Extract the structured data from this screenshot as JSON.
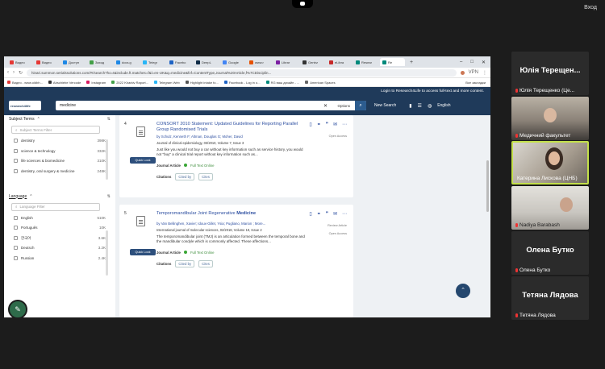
{
  "conference": {
    "exit_label": "Вход"
  },
  "browser": {
    "tabs": [
      {
        "label": "Видео",
        "color": "#e53935"
      },
      {
        "label": "Видео",
        "color": "#e53935"
      },
      {
        "label": "Доступ",
        "color": "#1e88e5"
      },
      {
        "label": "Заход",
        "color": "#43a047"
      },
      {
        "label": "docs.g",
        "color": "#1e88e5"
      },
      {
        "label": "Telegr",
        "color": "#29b6f6"
      },
      {
        "label": "Facebo",
        "color": "#1e63c4"
      },
      {
        "label": "DeepL",
        "color": "#0f2b46"
      },
      {
        "label": "Google",
        "color": "#4285f4"
      },
      {
        "label": "www.r",
        "color": "#e65100"
      },
      {
        "label": "Librar",
        "color": "#7b1fa2"
      },
      {
        "label": "Gentrz",
        "color": "#333333"
      },
      {
        "label": "eLibra",
        "color": "#c62828"
      },
      {
        "label": "Resear",
        "color": "#00897b"
      },
      {
        "label": "Re",
        "color": "#00897b",
        "active": true
      }
    ],
    "url": "hinari.summon.serialssolutions.com/#!/search?ho=t&include.ft.matches=f&l=en-UK&q=medicine&fvf=ContentType,Journal%20Article,f%7CDisciplin...",
    "vpn_label": "VPN",
    "bookmarks": [
      {
        "label": "Видео - www.oldbh...",
        "color": "#e53935"
      },
      {
        "label": "Abschiebe Vercode",
        "color": "#333333"
      },
      {
        "label": "Instagram",
        "color": "#d81b60"
      },
      {
        "label": "2022 Kharkiv Raport...",
        "color": "#43a047"
      },
      {
        "label": "Telegram Web",
        "color": "#29b6f6"
      },
      {
        "label": "Highlight intake fo...",
        "color": "#555555"
      },
      {
        "label": "Facebook - Log in o...",
        "color": "#1e63c4"
      },
      {
        "label": "RG ваш дизайн - ...",
        "color": "#00897b"
      },
      {
        "label": "American Spaces",
        "color": "#666666"
      }
    ],
    "bookmarks_all": "Все закладки"
  },
  "research4life": {
    "login_text": "Login to Research4Life to access full-text and more content.",
    "logo_text": "research4life",
    "search_value": "medicine",
    "options_label": "Options",
    "new_search_label": "New Search",
    "language_label": "English"
  },
  "facets": {
    "subject": {
      "title": "Subject Terms",
      "filter_placeholder": "Subject Terms Filter",
      "items": [
        {
          "label": "dentistry",
          "count": "398K"
        },
        {
          "label": "science & technology",
          "count": "332K"
        },
        {
          "label": "life sciences & biomedicine",
          "count": "310K"
        },
        {
          "label": "dentistry, oral surgery & medicine",
          "count": "248K"
        }
      ]
    },
    "language": {
      "title": "Language",
      "filter_placeholder": "Language Filter",
      "items": [
        {
          "label": "English",
          "count": "510K"
        },
        {
          "label": "Português",
          "count": "10K"
        },
        {
          "label": "한국어",
          "count": "3.6K"
        },
        {
          "label": "Deutsch",
          "count": "3.2K"
        },
        {
          "label": "Russian",
          "count": "2.4K"
        }
      ]
    }
  },
  "results": [
    {
      "number": "4",
      "title": "CONSORT 2010 Statement: Updated Guidelines for Reporting Parallel Group Randomised Trials",
      "authors": "by Schulz, Kenneth F; Altman, Douglas G; Moher, David",
      "journal": "Journal of clinical epidemiology, 03/2010, Volume 7, Issue 3",
      "snippet": "Just like you would not buy a car without key information such as service history, you would not \"buy\" a clinical trial report without key information such as...",
      "quick_look": "Quick Look",
      "access": "Open Access",
      "type": "Journal Article",
      "fulltext": "Full Text Online",
      "citations": "Citations",
      "cited_by": "Cited by",
      "cites": "Cites"
    },
    {
      "number": "5",
      "title_pre": "Temporomandibular Joint Regenerative ",
      "title_bold": "Medicine",
      "authors": "by Van Bellinghen, Xavier; Idoux-Gillet, Ysia; Pugliano, Marion ; More...",
      "journal": "International journal of molecular sciences, 02/2018, Volume 19, Issue 2",
      "snippet": "The temporomandibular joint (TMJ) is an articulation formed between the temporal bone and the mandibular condyle which is commonly affected. These affections...",
      "quick_look": "Quick Look",
      "review": "Review Article",
      "access": "Open Access",
      "type": "Journal Article",
      "fulltext": "Full Text Online",
      "citations": "Citations",
      "cited_by": "Cited by",
      "cites": "Cites"
    }
  ],
  "participants": [
    {
      "display": "Юлія Терещен...",
      "label": "Юлія Терещенко (Це..."
    },
    {
      "display": "",
      "label": "Медичний факультет"
    },
    {
      "display": "",
      "label": "Катерина Лискова (ЦНБ)"
    },
    {
      "display": "",
      "label": "Nadiya Barabash"
    },
    {
      "display": "Олена Бутко",
      "label": "Олена Бутко"
    },
    {
      "display": "Тетяна Лядова",
      "label": "Тетяна Лядова"
    }
  ]
}
